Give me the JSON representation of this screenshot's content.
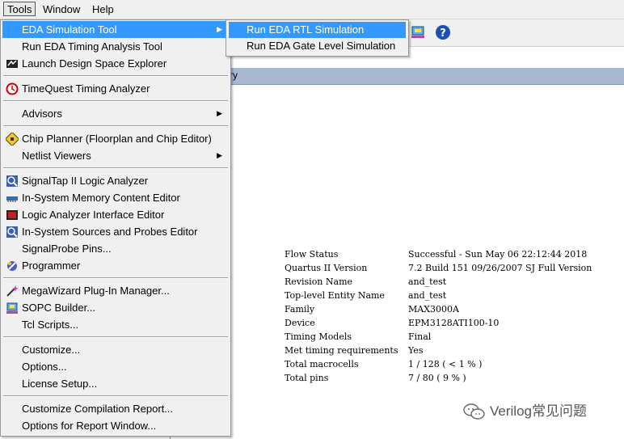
{
  "menubar": {
    "items": [
      {
        "label": "Tools",
        "active": true
      },
      {
        "label": "Window"
      },
      {
        "label": "Help"
      }
    ]
  },
  "tools_menu": {
    "items": [
      {
        "label": "EDA Simulation Tool",
        "submenu": true,
        "highlighted": true,
        "icon": "none"
      },
      {
        "label": "Run EDA Timing Analysis Tool",
        "icon": "none"
      },
      {
        "label": "Launch Design Space Explorer",
        "icon": "dse-icon"
      },
      {
        "label": "TimeQuest Timing Analyzer",
        "icon": "timequest-icon"
      },
      {
        "label": "Advisors",
        "submenu": true,
        "icon": "none"
      },
      {
        "label": "Chip Planner (Floorplan and Chip Editor)",
        "icon": "chip-planner-icon"
      },
      {
        "label": "Netlist Viewers",
        "submenu": true,
        "icon": "none"
      },
      {
        "label": "SignalTap II Logic Analyzer",
        "icon": "signaltap-icon"
      },
      {
        "label": "In-System Memory Content Editor",
        "icon": "memory-editor-icon"
      },
      {
        "label": "Logic Analyzer Interface Editor",
        "icon": "logic-analyzer-icon"
      },
      {
        "label": "In-System Sources and Probes Editor",
        "icon": "sources-probes-icon"
      },
      {
        "label": "SignalProbe Pins...",
        "icon": "none"
      },
      {
        "label": "Programmer",
        "icon": "programmer-icon"
      },
      {
        "label": "MegaWizard Plug-In Manager...",
        "icon": "megawizard-icon"
      },
      {
        "label": "SOPC Builder...",
        "icon": "sopc-icon"
      },
      {
        "label": "Tcl Scripts...",
        "icon": "none"
      },
      {
        "label": "Customize...",
        "icon": "none"
      },
      {
        "label": "Options...",
        "icon": "none"
      },
      {
        "label": "License Setup...",
        "icon": "none"
      },
      {
        "label": "Customize Compilation Report...",
        "icon": "none"
      },
      {
        "label": "Options for Report Window...",
        "icon": "none"
      }
    ]
  },
  "submenu": {
    "items": [
      {
        "label": "Run EDA RTL Simulation",
        "highlighted": true
      },
      {
        "label": "Run EDA Gate Level Simulation"
      }
    ]
  },
  "report": {
    "header_fragment": "ry"
  },
  "flow_summary": {
    "rows": [
      {
        "key": "Flow Status",
        "value": "Successful - Sun May 06 22:12:44 2018"
      },
      {
        "key": "Quartus II Version",
        "value": "7.2 Build 151 09/26/2007 SJ Full Version"
      },
      {
        "key": "Revision Name",
        "value": "and_test"
      },
      {
        "key": "Top-level Entity Name",
        "value": "and_test"
      },
      {
        "key": "Family",
        "value": "MAX3000A"
      },
      {
        "key": "Device",
        "value": "EPM3128ATI100-10"
      },
      {
        "key": "Timing Models",
        "value": "Final"
      },
      {
        "key": "Met timing requirements",
        "value": "Yes"
      },
      {
        "key": "Total macrocells",
        "value": "1 / 128 ( < 1 % )"
      },
      {
        "key": "Total pins",
        "value": "7 / 80 ( 9 % )"
      }
    ]
  },
  "watermark": {
    "text": "Verilog常见问题",
    "icon": "wechat-icon"
  },
  "colors": {
    "highlight": "#3399ff",
    "menu_bg": "#f0f0f0",
    "report_header": "#a8b8d0"
  }
}
